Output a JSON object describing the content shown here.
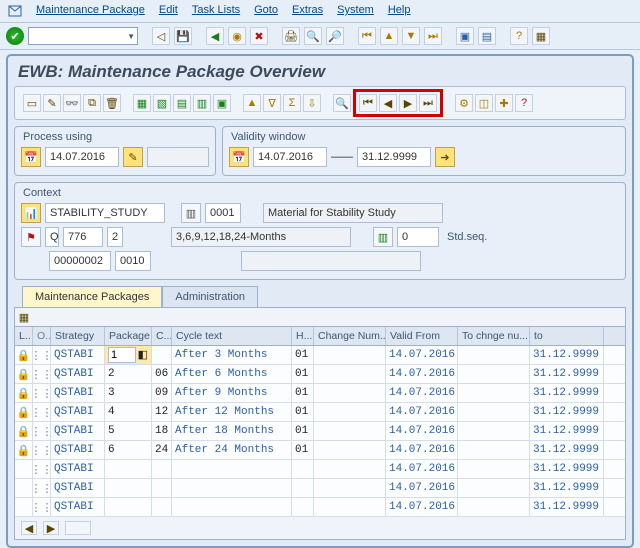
{
  "menubar": {
    "items": [
      "Maintenance Package",
      "Edit",
      "Task Lists",
      "Goto",
      "Extras",
      "System",
      "Help"
    ]
  },
  "page_title": "EWB: Maintenance Package Overview",
  "process_using": {
    "title": "Process using",
    "date": "14.07.2016",
    "extra": ""
  },
  "validity": {
    "title": "Validity window",
    "from": "14.07.2016",
    "to": "31.12.9999"
  },
  "context": {
    "title": "Context",
    "study": "STABILITY_STUDY",
    "batch": "0001",
    "material_desc": "Material for Stability Study",
    "q": "Q",
    "num1": "776",
    "num2": "2",
    "months": "3,6,9,12,18,24-Months",
    "seq_val": "0",
    "seq_label": "Std.seq.",
    "code1": "00000002",
    "code2": "0010"
  },
  "tabs": {
    "active": "Maintenance Packages",
    "inactive": "Administration"
  },
  "grid": {
    "headers": [
      "L..",
      "O..",
      "Strategy",
      "Package",
      "C...",
      "Cycle text",
      "H...",
      "Change Num...",
      "Valid From",
      "To chnge nu...",
      "to"
    ],
    "rows": [
      {
        "lock": true,
        "o": true,
        "strategy": "QSTABI",
        "package": "1",
        "c": "",
        "cycle": "After 3 Months",
        "h": "01",
        "change": "",
        "from": "14.07.2016",
        "tocng": "",
        "to": "31.12.9999",
        "sel": true
      },
      {
        "lock": true,
        "o": true,
        "strategy": "QSTABI",
        "package": "2",
        "c": "06",
        "cycle": "After 6 Months",
        "h": "01",
        "change": "",
        "from": "14.07.2016",
        "tocng": "",
        "to": "31.12.9999"
      },
      {
        "lock": true,
        "o": true,
        "strategy": "QSTABI",
        "package": "3",
        "c": "09",
        "cycle": "After 9 Months",
        "h": "01",
        "change": "",
        "from": "14.07.2016",
        "tocng": "",
        "to": "31.12.9999"
      },
      {
        "lock": true,
        "o": true,
        "strategy": "QSTABI",
        "package": "4",
        "c": "12",
        "cycle": "After 12 Months",
        "h": "01",
        "change": "",
        "from": "14.07.2016",
        "tocng": "",
        "to": "31.12.9999"
      },
      {
        "lock": true,
        "o": true,
        "strategy": "QSTABI",
        "package": "5",
        "c": "18",
        "cycle": "After 18 Months",
        "h": "01",
        "change": "",
        "from": "14.07.2016",
        "tocng": "",
        "to": "31.12.9999"
      },
      {
        "lock": true,
        "o": true,
        "strategy": "QSTABI",
        "package": "6",
        "c": "24",
        "cycle": "After 24 Months",
        "h": "01",
        "change": "",
        "from": "14.07.2016",
        "tocng": "",
        "to": "31.12.9999"
      },
      {
        "lock": false,
        "o": true,
        "strategy": "QSTABI",
        "package": "",
        "c": "",
        "cycle": "",
        "h": "",
        "change": "",
        "from": "14.07.2016",
        "tocng": "",
        "to": "31.12.9999"
      },
      {
        "lock": false,
        "o": true,
        "strategy": "QSTABI",
        "package": "",
        "c": "",
        "cycle": "",
        "h": "",
        "change": "",
        "from": "14.07.2016",
        "tocng": "",
        "to": "31.12.9999"
      },
      {
        "lock": false,
        "o": true,
        "strategy": "QSTABI",
        "package": "",
        "c": "",
        "cycle": "",
        "h": "",
        "change": "",
        "from": "14.07.2016",
        "tocng": "",
        "to": "31.12.9999"
      }
    ]
  }
}
